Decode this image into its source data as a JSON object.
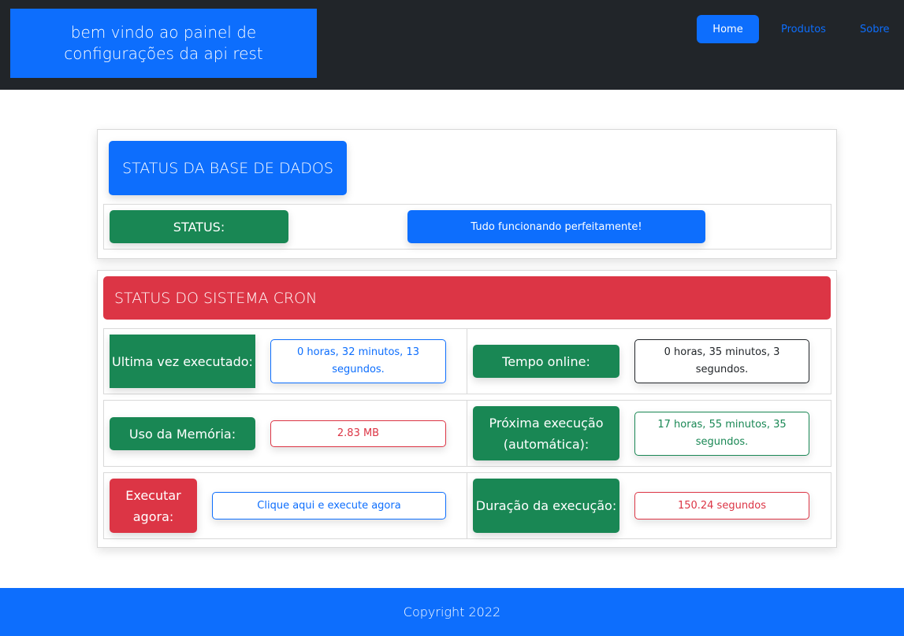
{
  "header": {
    "brand_text": "bem vindo ao painel de configurações da api rest",
    "nav": {
      "home": "Home",
      "produtos": "Produtos",
      "sobre": "Sobre"
    }
  },
  "database": {
    "title": "STATUS DA BASE DE DADOS",
    "status_label": "STATUS:",
    "status_value": "Tudo funcionando perfeitamente!"
  },
  "cron": {
    "title": "STATUS DO SISTEMA CRON",
    "last_run_label": "Ultima vez executado:",
    "last_run_value": "0 horas, 32 minutos, 13 segundos.",
    "uptime_label": "Tempo online:",
    "uptime_value": "0 horas, 35 minutos, 3 segundos.",
    "memory_label": "Uso da Memória:",
    "memory_value": "2.83 MB",
    "next_run_label": "Próxima execução (automática):",
    "next_run_value": "17 horas, 55 minutos, 35 segundos.",
    "run_now_label": "Executar agora:",
    "run_now_button": "Clique aqui e execute agora",
    "duration_label": "Duração da execução:",
    "duration_value": "150.24 segundos"
  },
  "footer": {
    "copyright": "Copyright 2022"
  },
  "colors": {
    "primary": "#0d6efd",
    "success": "#198754",
    "danger": "#dc3545",
    "dark": "#212529"
  }
}
